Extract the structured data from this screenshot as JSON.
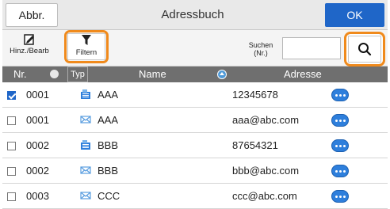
{
  "titlebar": {
    "back_label": "Abbr.",
    "title": "Adressbuch",
    "ok_label": "OK"
  },
  "toolbar": {
    "add_edit_label": "Hinz./Bearb",
    "filter_label": "Filtern",
    "search_label_line1": "Suchen",
    "search_label_line2": "(Nr.)",
    "search_value": ""
  },
  "table": {
    "headers": {
      "nr": "Nr.",
      "typ": "Typ",
      "name": "Name",
      "address": "Adresse"
    },
    "rows": [
      {
        "checked": true,
        "nr": "0001",
        "type": "fax-icon",
        "name": "AAA",
        "address": "12345678"
      },
      {
        "checked": false,
        "nr": "0001",
        "type": "mail-icon",
        "name": "AAA",
        "address": "aaa@abc.com"
      },
      {
        "checked": false,
        "nr": "0002",
        "type": "fax-icon",
        "name": "BBB",
        "address": "87654321"
      },
      {
        "checked": false,
        "nr": "0002",
        "type": "mail-icon",
        "name": "BBB",
        "address": "bbb@abc.com"
      },
      {
        "checked": false,
        "nr": "0003",
        "type": "mail-icon",
        "name": "CCC",
        "address": "ccc@abc.com"
      }
    ]
  },
  "colors": {
    "accent": "#1f66c8",
    "highlight": "#f08a1c",
    "header_bg": "#6f6f6f",
    "more_button": "#2e7fdc"
  }
}
